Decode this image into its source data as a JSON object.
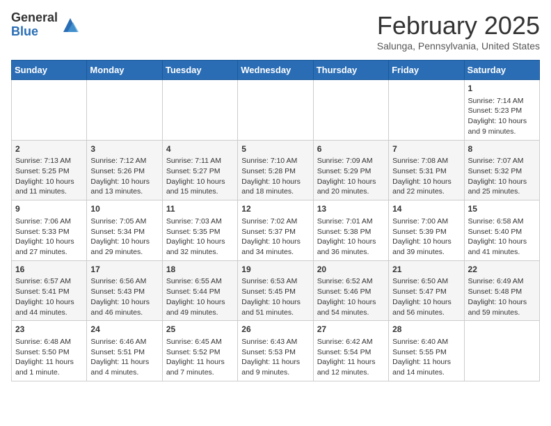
{
  "header": {
    "logo": {
      "general": "General",
      "blue": "Blue"
    },
    "title": "February 2025",
    "subtitle": "Salunga, Pennsylvania, United States"
  },
  "calendar": {
    "days_of_week": [
      "Sunday",
      "Monday",
      "Tuesday",
      "Wednesday",
      "Thursday",
      "Friday",
      "Saturday"
    ],
    "weeks": [
      [
        {
          "day": "",
          "info": ""
        },
        {
          "day": "",
          "info": ""
        },
        {
          "day": "",
          "info": ""
        },
        {
          "day": "",
          "info": ""
        },
        {
          "day": "",
          "info": ""
        },
        {
          "day": "",
          "info": ""
        },
        {
          "day": "1",
          "info": "Sunrise: 7:14 AM\nSunset: 5:23 PM\nDaylight: 10 hours and 9 minutes."
        }
      ],
      [
        {
          "day": "2",
          "info": "Sunrise: 7:13 AM\nSunset: 5:25 PM\nDaylight: 10 hours and 11 minutes."
        },
        {
          "day": "3",
          "info": "Sunrise: 7:12 AM\nSunset: 5:26 PM\nDaylight: 10 hours and 13 minutes."
        },
        {
          "day": "4",
          "info": "Sunrise: 7:11 AM\nSunset: 5:27 PM\nDaylight: 10 hours and 15 minutes."
        },
        {
          "day": "5",
          "info": "Sunrise: 7:10 AM\nSunset: 5:28 PM\nDaylight: 10 hours and 18 minutes."
        },
        {
          "day": "6",
          "info": "Sunrise: 7:09 AM\nSunset: 5:29 PM\nDaylight: 10 hours and 20 minutes."
        },
        {
          "day": "7",
          "info": "Sunrise: 7:08 AM\nSunset: 5:31 PM\nDaylight: 10 hours and 22 minutes."
        },
        {
          "day": "8",
          "info": "Sunrise: 7:07 AM\nSunset: 5:32 PM\nDaylight: 10 hours and 25 minutes."
        }
      ],
      [
        {
          "day": "9",
          "info": "Sunrise: 7:06 AM\nSunset: 5:33 PM\nDaylight: 10 hours and 27 minutes."
        },
        {
          "day": "10",
          "info": "Sunrise: 7:05 AM\nSunset: 5:34 PM\nDaylight: 10 hours and 29 minutes."
        },
        {
          "day": "11",
          "info": "Sunrise: 7:03 AM\nSunset: 5:35 PM\nDaylight: 10 hours and 32 minutes."
        },
        {
          "day": "12",
          "info": "Sunrise: 7:02 AM\nSunset: 5:37 PM\nDaylight: 10 hours and 34 minutes."
        },
        {
          "day": "13",
          "info": "Sunrise: 7:01 AM\nSunset: 5:38 PM\nDaylight: 10 hours and 36 minutes."
        },
        {
          "day": "14",
          "info": "Sunrise: 7:00 AM\nSunset: 5:39 PM\nDaylight: 10 hours and 39 minutes."
        },
        {
          "day": "15",
          "info": "Sunrise: 6:58 AM\nSunset: 5:40 PM\nDaylight: 10 hours and 41 minutes."
        }
      ],
      [
        {
          "day": "16",
          "info": "Sunrise: 6:57 AM\nSunset: 5:41 PM\nDaylight: 10 hours and 44 minutes."
        },
        {
          "day": "17",
          "info": "Sunrise: 6:56 AM\nSunset: 5:43 PM\nDaylight: 10 hours and 46 minutes."
        },
        {
          "day": "18",
          "info": "Sunrise: 6:55 AM\nSunset: 5:44 PM\nDaylight: 10 hours and 49 minutes."
        },
        {
          "day": "19",
          "info": "Sunrise: 6:53 AM\nSunset: 5:45 PM\nDaylight: 10 hours and 51 minutes."
        },
        {
          "day": "20",
          "info": "Sunrise: 6:52 AM\nSunset: 5:46 PM\nDaylight: 10 hours and 54 minutes."
        },
        {
          "day": "21",
          "info": "Sunrise: 6:50 AM\nSunset: 5:47 PM\nDaylight: 10 hours and 56 minutes."
        },
        {
          "day": "22",
          "info": "Sunrise: 6:49 AM\nSunset: 5:48 PM\nDaylight: 10 hours and 59 minutes."
        }
      ],
      [
        {
          "day": "23",
          "info": "Sunrise: 6:48 AM\nSunset: 5:50 PM\nDaylight: 11 hours and 1 minute."
        },
        {
          "day": "24",
          "info": "Sunrise: 6:46 AM\nSunset: 5:51 PM\nDaylight: 11 hours and 4 minutes."
        },
        {
          "day": "25",
          "info": "Sunrise: 6:45 AM\nSunset: 5:52 PM\nDaylight: 11 hours and 7 minutes."
        },
        {
          "day": "26",
          "info": "Sunrise: 6:43 AM\nSunset: 5:53 PM\nDaylight: 11 hours and 9 minutes."
        },
        {
          "day": "27",
          "info": "Sunrise: 6:42 AM\nSunset: 5:54 PM\nDaylight: 11 hours and 12 minutes."
        },
        {
          "day": "28",
          "info": "Sunrise: 6:40 AM\nSunset: 5:55 PM\nDaylight: 11 hours and 14 minutes."
        },
        {
          "day": "",
          "info": ""
        }
      ]
    ]
  }
}
